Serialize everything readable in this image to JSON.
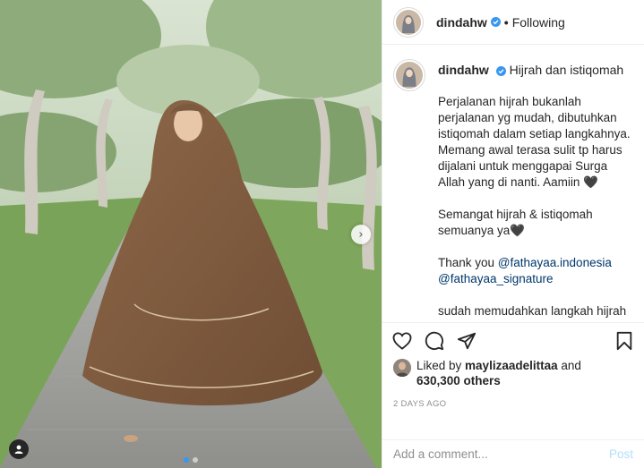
{
  "header": {
    "username": "dindahw",
    "separator": "•",
    "follow_status": "Following",
    "verified_icon": "verified-badge-icon"
  },
  "caption": {
    "username": "dindahw",
    "title": "Hijrah dan istiqomah",
    "paragraphs": [
      "Perjalanan hijrah bukanlah\nperjalanan yg mudah, dibutuhkan\nistiqomah dalam setiap langkahnya.\nMemang awal terasa sulit tp harus\ndijalani untuk menggapai Surga\nAllah yang di nanti. Aamiin 🖤",
      "Semangat hijrah & istiqomah\nsemuanya ya🖤"
    ],
    "thanks_prefix": "Thank you ",
    "mention_1": "@fathayaa.indonesia",
    "mention_2": "@fathayaa_signature",
    "closing": "sudah memudahkan langkah hijrah\nmuslimah indonesia dalam berhijrah\nmemakai pakaian syari seperti yg\naku pakai ini dengan harga hemat"
  },
  "likes": {
    "prefix": "Liked by ",
    "liker": "maylizaadelittaa",
    "conj": " and",
    "others": "630,300 others"
  },
  "timestamp": "2 DAYS AGO",
  "comment_box": {
    "placeholder": "Add a comment...",
    "post_label": "Post"
  },
  "carousel": {
    "total_slides": 2,
    "active_slide": 1
  },
  "colors": {
    "accent_blue": "#3897f0",
    "mention_blue": "#00376b",
    "post_disabled": "#b2dffc",
    "border": "#efefef",
    "muted": "#8e8e8e"
  }
}
